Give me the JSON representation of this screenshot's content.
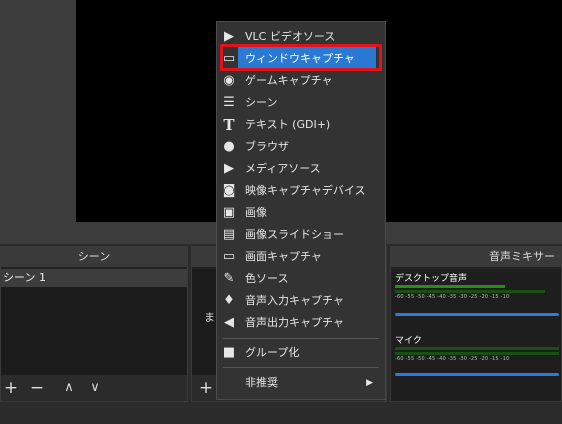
{
  "preview": {},
  "scenes_dock": {
    "title": "シーン",
    "items": [
      "シーン 1"
    ],
    "toolbar": {
      "add": "+",
      "remove": "−",
      "up": "∧",
      "down": "∨"
    }
  },
  "sources_dock": {
    "partial_text": "ま",
    "toolbar": {
      "add": "+"
    }
  },
  "mixer_dock": {
    "title": "音声ミキサー",
    "channels": [
      {
        "name": "デスクトップ音声",
        "ticks": "-60  -55  -50  -45  -40  -35  -30  -25  -20  -15  -10"
      },
      {
        "name": "マイク",
        "ticks": "-60  -55  -50  -45  -40  -35  -30  -25  -20  -15  -10"
      }
    ]
  },
  "context_menu": {
    "items": [
      {
        "label": "VLC ビデオソース",
        "icon": "play-icon"
      },
      {
        "label": "ウィンドウキャプチャ",
        "icon": "window-icon",
        "highlighted": true
      },
      {
        "label": "ゲームキャプチャ",
        "icon": "gamepad-icon"
      },
      {
        "label": "シーン",
        "icon": "list-icon"
      },
      {
        "label": "テキスト (GDI+)",
        "icon": "text-icon"
      },
      {
        "label": "ブラウザ",
        "icon": "globe-icon"
      },
      {
        "label": "メディアソース",
        "icon": "play-icon"
      },
      {
        "label": "映像キャプチャデバイス",
        "icon": "camera-icon"
      },
      {
        "label": "画像",
        "icon": "image-icon"
      },
      {
        "label": "画像スライドショー",
        "icon": "slideshow-icon"
      },
      {
        "label": "画面キャプチャ",
        "icon": "monitor-icon"
      },
      {
        "label": "色ソース",
        "icon": "brush-icon"
      },
      {
        "label": "音声入力キャプチャ",
        "icon": "microphone-icon"
      },
      {
        "label": "音声出力キャプチャ",
        "icon": "speaker-icon"
      },
      {
        "label": "グループ化",
        "icon": "folder-icon"
      },
      {
        "label": "非推奨",
        "icon": "",
        "submenu": true
      }
    ]
  },
  "colors": {
    "highlight": "#2a7ad3",
    "annotation": "#e0121b",
    "meter": "#2c8a1e",
    "slider": "#2d7bd6"
  }
}
